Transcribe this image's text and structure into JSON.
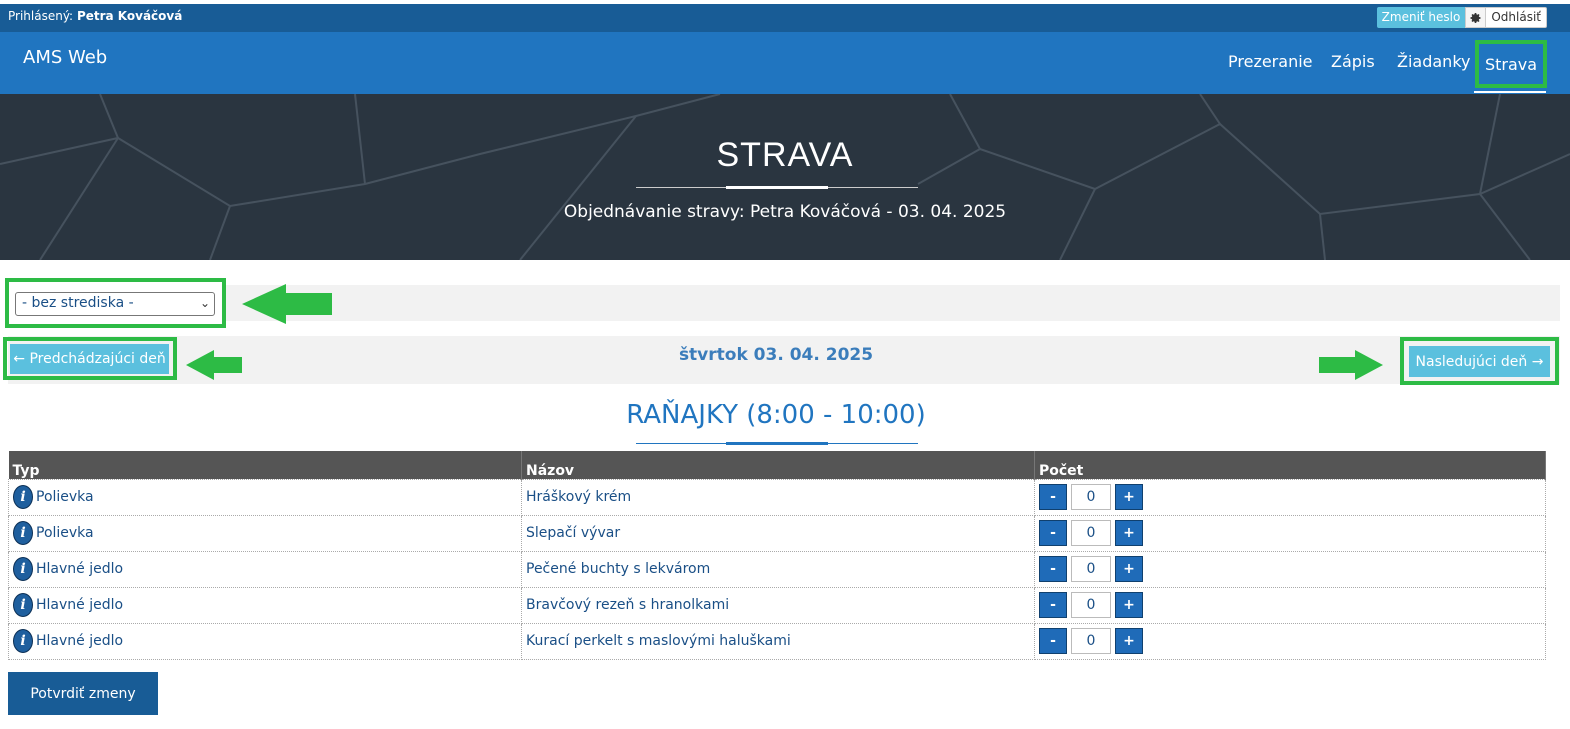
{
  "topbar": {
    "login_label": "Prihlásený:",
    "user_name": "Petra Kováčová",
    "change_password": "Zmeniť heslo",
    "settings_icon": "gear-icon",
    "logout": "Odhlásiť"
  },
  "navbar": {
    "brand": "AMS Web",
    "items": [
      {
        "label": "Prezeranie"
      },
      {
        "label": "Zápis"
      },
      {
        "label": "Žiadanky"
      },
      {
        "label": "Strava"
      }
    ],
    "active": "Strava"
  },
  "hero": {
    "title": "STRAVA",
    "subtitle": "Objednávanie stravy: Petra Kováčová - 03. 04. 2025"
  },
  "filter": {
    "center_select": "- bez strediska -"
  },
  "day": {
    "prev": "← Predchádzajúci deň",
    "title": "štvrtok 03. 04. 2025",
    "next": "Nasledujúci deň →"
  },
  "section": {
    "title": "RAŇAJKY (8:00 - 10:00)"
  },
  "table": {
    "headers": [
      "Typ",
      "Názov",
      "Počet"
    ],
    "rows": [
      {
        "type": "Polievka",
        "name": "Hráškový krém",
        "count": "0"
      },
      {
        "type": "Polievka",
        "name": "Slepačí vývar",
        "count": "0"
      },
      {
        "type": "Hlavné jedlo",
        "name": "Pečené buchty s lekvárom",
        "count": "0"
      },
      {
        "type": "Hlavné jedlo",
        "name": "Bravčový rezeň s hranolkami",
        "count": "0"
      },
      {
        "type": "Hlavné jedlo",
        "name": "Kurací perkelt s maslovými haluškami",
        "count": "0"
      }
    ],
    "minus": "-",
    "plus": "+",
    "info": "i"
  },
  "confirm": "Potvrdiť zmeny",
  "colors": {
    "nav": "#2075c0",
    "topbar": "#185c96",
    "highlight": "#2dbb45",
    "button_info": "#5bc0de"
  }
}
